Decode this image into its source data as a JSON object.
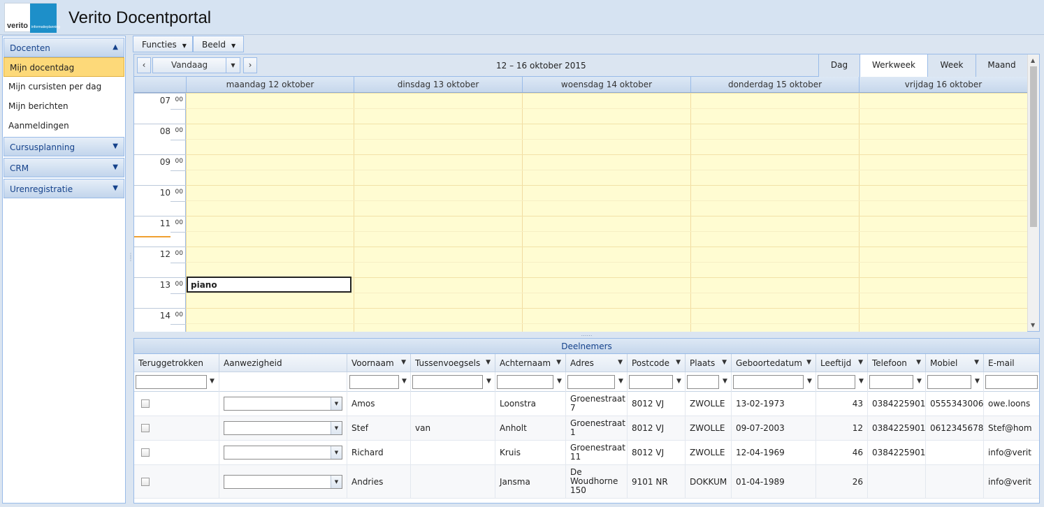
{
  "app": {
    "title": "Verito Docentportal",
    "logo_text": "verito",
    "logo_subtext": "informatieplanning"
  },
  "sidebar": {
    "sections": [
      {
        "label": "Docenten",
        "expanded": true,
        "items": [
          {
            "label": "Mijn docentdag",
            "selected": true
          },
          {
            "label": "Mijn cursisten per dag"
          },
          {
            "label": "Mijn berichten"
          },
          {
            "label": "Aanmeldingen"
          }
        ]
      },
      {
        "label": "Cursusplanning",
        "expanded": false
      },
      {
        "label": "CRM",
        "expanded": false
      },
      {
        "label": "Urenregistratie",
        "expanded": false
      }
    ]
  },
  "menubar": {
    "functies_label": "Functies",
    "beeld_label": "Beeld"
  },
  "scheduler": {
    "today_label": "Vandaag",
    "date_range": "12 – 16 oktober 2015",
    "views": {
      "dag": "Dag",
      "werkweek": "Werkweek",
      "week": "Week",
      "maand": "Maand",
      "active": "Werkweek"
    },
    "days": [
      "maandag 12 oktober",
      "dinsdag 13 oktober",
      "woensdag 14 oktober",
      "donderdag 15 oktober",
      "vrijdag 16 oktober"
    ],
    "hours": [
      "07",
      "08",
      "09",
      "10",
      "11",
      "12",
      "13",
      "14"
    ],
    "minutes_label": "00",
    "appointment": {
      "title": "piano",
      "day": "maandag 12 oktober",
      "start": "13:00"
    }
  },
  "participants": {
    "title": "Deelnemers",
    "columns": {
      "teruggetrokken": "Teruggetrokken",
      "aanwezigheid": "Aanwezigheid",
      "voornaam": "Voornaam",
      "tussenvoegsels": "Tussenvoegsels",
      "achternaam": "Achternaam",
      "adres": "Adres",
      "postcode": "Postcode",
      "plaats": "Plaats",
      "geboortedatum": "Geboortedatum",
      "leeftijd": "Leeftijd",
      "telefoon": "Telefoon",
      "mobiel": "Mobiel",
      "email": "E-mail"
    },
    "rows": [
      {
        "voornaam": "Amos",
        "tussenvoegsels": "",
        "achternaam": "Loonstra",
        "adres": "Groenestraat 7",
        "postcode": "8012 VJ",
        "plaats": "ZWOLLE",
        "geboortedatum": "13-02-1973",
        "leeftijd": "43",
        "telefoon": "0384225901",
        "mobiel": "0555343006",
        "email": "owe.loons"
      },
      {
        "voornaam": "Stef",
        "tussenvoegsels": "van",
        "achternaam": "Anholt",
        "adres": "Groenestraat 1",
        "postcode": "8012 VJ",
        "plaats": "ZWOLLE",
        "geboortedatum": "09-07-2003",
        "leeftijd": "12",
        "telefoon": "0384225901",
        "mobiel": "0612345678",
        "email": "Stef@hom"
      },
      {
        "voornaam": "Richard",
        "tussenvoegsels": "",
        "achternaam": "Kruis",
        "adres": "Groenestraat 11",
        "postcode": "8012 VJ",
        "plaats": "ZWOLLE",
        "geboortedatum": "12-04-1969",
        "leeftijd": "46",
        "telefoon": "0384225901",
        "mobiel": "",
        "email": "info@verit"
      },
      {
        "voornaam": "Andries",
        "tussenvoegsels": "",
        "achternaam": "Jansma",
        "adres": "De Woudhorne 150",
        "postcode": "9101 NR",
        "plaats": "DOKKUM",
        "geboortedatum": "01-04-1989",
        "leeftijd": "26",
        "telefoon": "",
        "mobiel": "",
        "email": "info@verit"
      }
    ]
  },
  "colors": {
    "accent": "#15428b",
    "selected": "#fdd979",
    "calendar_bg": "#fffcd2",
    "border": "#99bbe8"
  }
}
